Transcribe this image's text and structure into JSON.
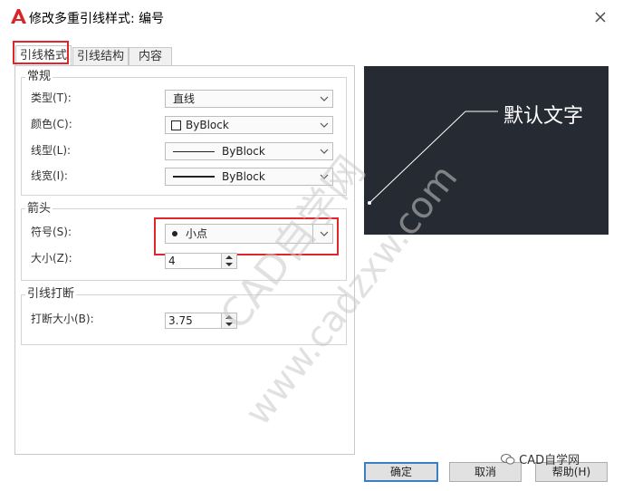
{
  "window": {
    "title": "修改多重引线样式: 编号"
  },
  "tabs": [
    {
      "label": "引线格式"
    },
    {
      "label": "引线结构"
    },
    {
      "label": "内容"
    }
  ],
  "general": {
    "title": "常规",
    "type_label": "类型(T):",
    "type_value": "直线",
    "color_label": "颜色(C):",
    "color_value": "ByBlock",
    "linetype_label": "线型(L):",
    "linetype_value": "ByBlock",
    "lineweight_label": "线宽(I):",
    "lineweight_value": "ByBlock"
  },
  "arrowhead": {
    "title": "箭头",
    "symbol_label": "符号(S):",
    "symbol_value": "小点",
    "size_label": "大小(Z):",
    "size_value": "4"
  },
  "break": {
    "title": "引线打断",
    "size_label": "打断大小(B):",
    "size_value": "3.75"
  },
  "preview": {
    "text": "默认文字"
  },
  "buttons": {
    "ok": "确定",
    "cancel": "取消",
    "help": "帮助(H)"
  },
  "watermarks": {
    "main": "CAD自学网",
    "url": "www.cadzxw.com",
    "corner": "CAD自学网"
  },
  "colors": {
    "highlight": "#e0252b",
    "preview_bg": "#262a33",
    "ok_border": "#3c7fc4"
  }
}
